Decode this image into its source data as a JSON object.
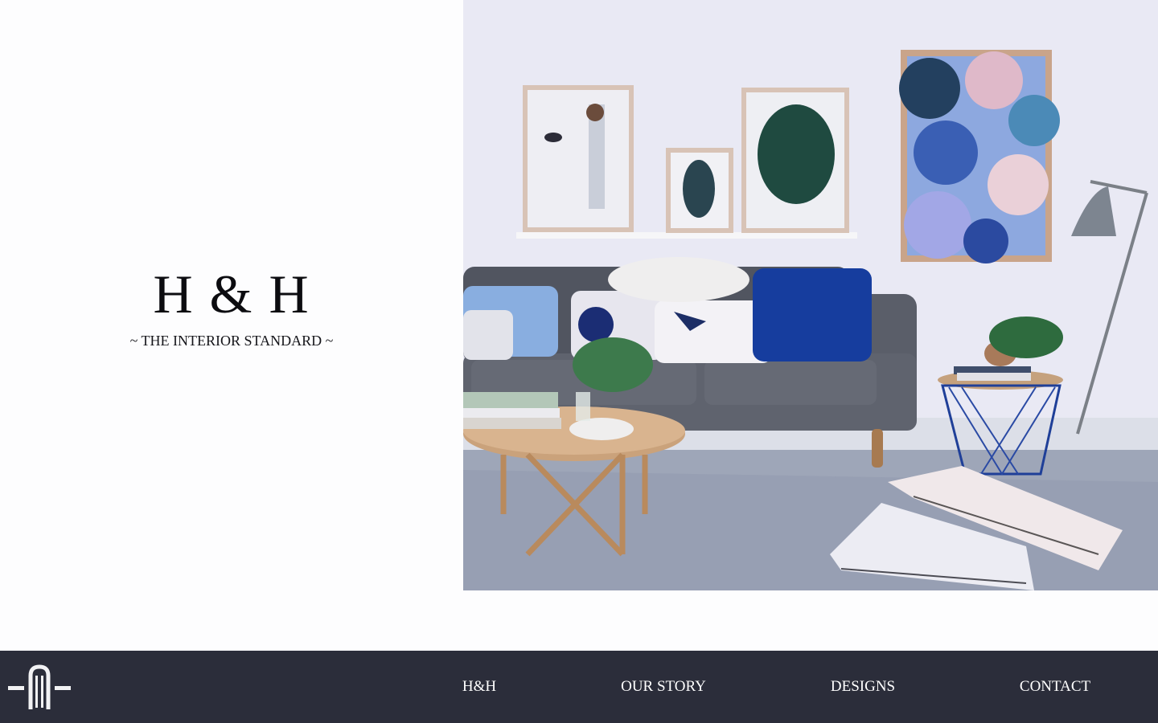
{
  "brand": {
    "title": "H & H",
    "tagline": "~ THE INTERIOR STANDARD ~"
  },
  "hero": {
    "image": "living-room-photo"
  },
  "nav": {
    "logo_icon": "monogram-logo-icon",
    "items": [
      {
        "label": "H&H"
      },
      {
        "label": "OUR STORY"
      },
      {
        "label": "DESIGNS"
      },
      {
        "label": "CONTACT"
      }
    ]
  },
  "colors": {
    "navbar": "#2b2d3a",
    "nav_text": "#ffffff",
    "background": "#fdfdfe",
    "brand_text": "#0c0c10"
  }
}
